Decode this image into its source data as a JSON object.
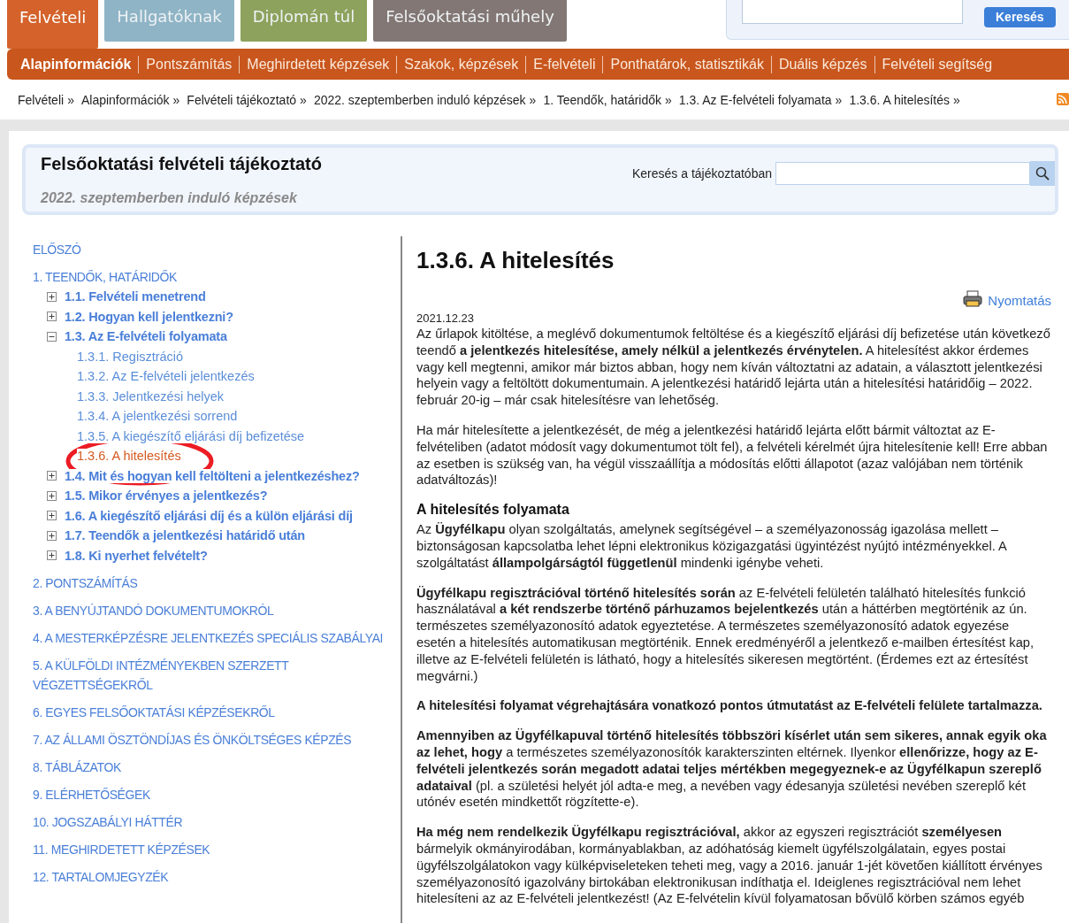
{
  "tabs": [
    {
      "label": "Felvételi",
      "selected": true,
      "color": "#d4622a"
    },
    {
      "label": "Hallgatóknak",
      "selected": false,
      "color": "#8fb4c6"
    },
    {
      "label": "Diplomán túl",
      "selected": false,
      "color": "#8da25c"
    },
    {
      "label": "Felsőoktatási műhely",
      "selected": false,
      "color": "#827774"
    }
  ],
  "top_search": {
    "button": "Keresés"
  },
  "nav": [
    {
      "label": "Alapinformációk",
      "selected": true
    },
    {
      "label": "Pontszámítás",
      "selected": false
    },
    {
      "label": "Meghirdetett képzések",
      "selected": false
    },
    {
      "label": "Szakok, képzések",
      "selected": false
    },
    {
      "label": "E-felvételi",
      "selected": false
    },
    {
      "label": "Ponthatárok, statisztikák",
      "selected": false
    },
    {
      "label": "Duális képzés",
      "selected": false
    },
    {
      "label": "Felvételi segítség",
      "selected": false
    }
  ],
  "breadcrumb": [
    {
      "label": "Felvételi",
      "sep": "»"
    },
    {
      "label": "Alapinformációk",
      "sep": "»"
    },
    {
      "label": "Felvételi tájékoztató",
      "sep": "»"
    },
    {
      "label": "2022. szeptemberben induló képzések",
      "sep": "»"
    },
    {
      "label": "1. Teendők, határidők",
      "sep": "»"
    },
    {
      "label": "1.3. Az E-felvételi folyamata",
      "sep": "»"
    },
    {
      "label": "1.3.6. A hitelesítés",
      "sep": "»"
    }
  ],
  "header": {
    "title": "Felsőoktatási felvételi tájékoztató",
    "subtitle": "2022. szeptemberben induló képzések",
    "search_label": "Keresés a tájékoztatóban"
  },
  "toc": [
    {
      "label": "ELŐSZÓ"
    },
    {
      "label": "1. TEENDŐK, HATÁRIDŐK",
      "children": [
        {
          "label": "1.1. Felvételi menetrend",
          "expanded": false
        },
        {
          "label": "1.2. Hogyan kell jelentkezni?",
          "expanded": false
        },
        {
          "label": "1.3. Az E-felvételi folyamata",
          "expanded": true,
          "children": [
            {
              "label": "1.3.1. Regisztráció",
              "selected": false
            },
            {
              "label": "1.3.2. Az E-felvételi jelentkezés",
              "selected": false
            },
            {
              "label": "1.3.3. Jelentkezési helyek",
              "selected": false
            },
            {
              "label": "1.3.4. A jelentkezési sorrend",
              "selected": false
            },
            {
              "label": "1.3.5. A kiegészítő eljárási díj befizetése",
              "selected": false
            },
            {
              "label": "1.3.6. A hitelesítés",
              "selected": true
            }
          ]
        },
        {
          "label": "1.4. Mit és hogyan kell feltölteni a jelentkezéshez?",
          "expanded": false
        },
        {
          "label": "1.5. Mikor érvényes a jelentkezés?",
          "expanded": false
        },
        {
          "label": "1.6. A kiegészítő eljárási díj és a külön eljárási díj",
          "expanded": false
        },
        {
          "label": "1.7. Teendők a jelentkezési határidő után",
          "expanded": false
        },
        {
          "label": "1.8. Ki nyerhet felvételt?",
          "expanded": false
        }
      ]
    },
    {
      "label": "2. PONTSZÁMÍTÁS"
    },
    {
      "label": "3. A BENYÚJTANDÓ DOKUMENTUMOKRÓL"
    },
    {
      "label": "4. A MESTERKÉPZÉSRE JELENTKEZÉS SPECIÁLIS SZABÁLYAI"
    },
    {
      "label": "5. A KÜLFÖLDI INTÉZMÉNYEKBEN SZERZETT VÉGZETTSÉGEKRŐL"
    },
    {
      "label": "6. EGYES FELSŐOKTATÁSI KÉPZÉSEKRŐL"
    },
    {
      "label": "7. AZ ÁLLAMI ÖSZTÖNDÍJAS ÉS ÖNKÖLTSÉGES KÉPZÉS"
    },
    {
      "label": "8. TÁBLÁZATOK"
    },
    {
      "label": "9. ELÉRHETŐSÉGEK"
    },
    {
      "label": "10. JOGSZABÁLYI HÁTTÉR"
    },
    {
      "label": "11. MEGHIRDETETT KÉPZÉSEK"
    },
    {
      "label": "12. TARTALOMJEGYZÉK"
    }
  ],
  "article": {
    "title": "1.3.6. A hitelesítés",
    "print": "Nyomtatás",
    "date": "2021.12.23",
    "blocks": [
      {
        "kind": "paragraph",
        "text": "Az űrlapok kitöltése, a meglévő dokumentumok feltöltése és a kiegészítő eljárási díj befizetése után következő teendő **a jelentkezés hitelesítése, amely nélkül a jelentkezés érvénytelen.** A hitelesítést akkor érdemes vagy kell megtenni, amikor már biztos abban, hogy nem kíván változtatni az adatain, a választott jelentkezési helyein vagy a feltöltött dokumentumain. A jelentkezési határidő lejárta után a hitelesítési határidőig – 2022. február 20-ig – már csak hitelesítésre van lehetőség."
      },
      {
        "kind": "paragraph",
        "text": "Ha már hitelesítette a jelentkezését, de még a jelentkezési határidő lejárta előtt bármit változtat az E-felvételiben (adatot módosít vagy dokumentumot tölt fel), a felvételi kérelmét újra hitelesítenie kell! Erre abban az esetben is szükség van, ha végül visszaállítja a módosítás előtti állapotot (azaz valójában nem történik adatváltozás)!"
      },
      {
        "kind": "heading",
        "text": "A hitelesítés folyamata"
      },
      {
        "kind": "paragraph",
        "text": "Az **Ügyfélkapu** olyan szolgáltatás, amelynek segítségével – a személyazonosság igazolása mellett – biztonságosan kapcsolatba lehet lépni elektronikus közigazgatási ügyintézést nyújtó intézményekkel. A szolgáltatást **állampolgárságtól függetlenül** mindenki igénybe veheti."
      },
      {
        "kind": "paragraph",
        "text": "**Ügyfélkapu regisztrációval történő hitelesítés során** az E-felvételi felületén található hitelesítés funkció használatával **a két rendszerbe történő párhuzamos bejelentkezés** után a háttérben megtörténik az ún. természetes személyazonosító adatok egyeztetése. A természetes személyazonosító adatok egyezése esetén a hitelesítés automatikusan megtörténik. Ennek eredményéről a jelentkező e-mailben értesítést kap, illetve az E-felvételi felületén is látható, hogy a hitelesítés sikeresen megtörtént. (Érdemes ezt az értesítést megvárni.)"
      },
      {
        "kind": "bold",
        "text": "A hitelesítési folyamat végrehajtására vonatkozó pontos útmutatást az E-felvételi felülete tartalmazza."
      },
      {
        "kind": "paragraph",
        "text": "**Amennyiben az Ügyfélkapuval történő hitelesítés többszöri kísérlet után sem sikeres, annak egyik oka az lehet, hogy** a természetes személyazonosítók karakterszinten eltérnek. Ilyenkor **ellenőrizze, hogy az E-felvételi jelentkezés során megadott adatai teljes mértékben megegyeznek-e az Ügyfélkapun szereplő adataival** (pl. a születési helyét jól adta-e meg, a nevében vagy édesanyja születési nevében szereplő két utónév esetén mindkettőt rögzítette-e)."
      },
      {
        "kind": "paragraph",
        "text": "**Ha még nem rendelkezik Ügyfélkapu regisztrációval,** akkor az egyszeri regisztrációt **személyesen** bármelyik okmányirodában, kormányablakban, az adóhatóság kiemelt ügyfélszolgálatain, egyes postai ügyfélszolgálatokon vagy külképviseleteken teheti meg, vagy a 2016. január 1-jét követően kiállított érvényes személyazonosító igazolvány birtokában elektronikusan indíthatja el. Ideiglenes regisztrációval nem lehet hitelesíteni az az E-felvételi jelentkezést! (Az E-felvételin kívül folyamatosan bővülő körben számos egyéb"
      }
    ]
  }
}
